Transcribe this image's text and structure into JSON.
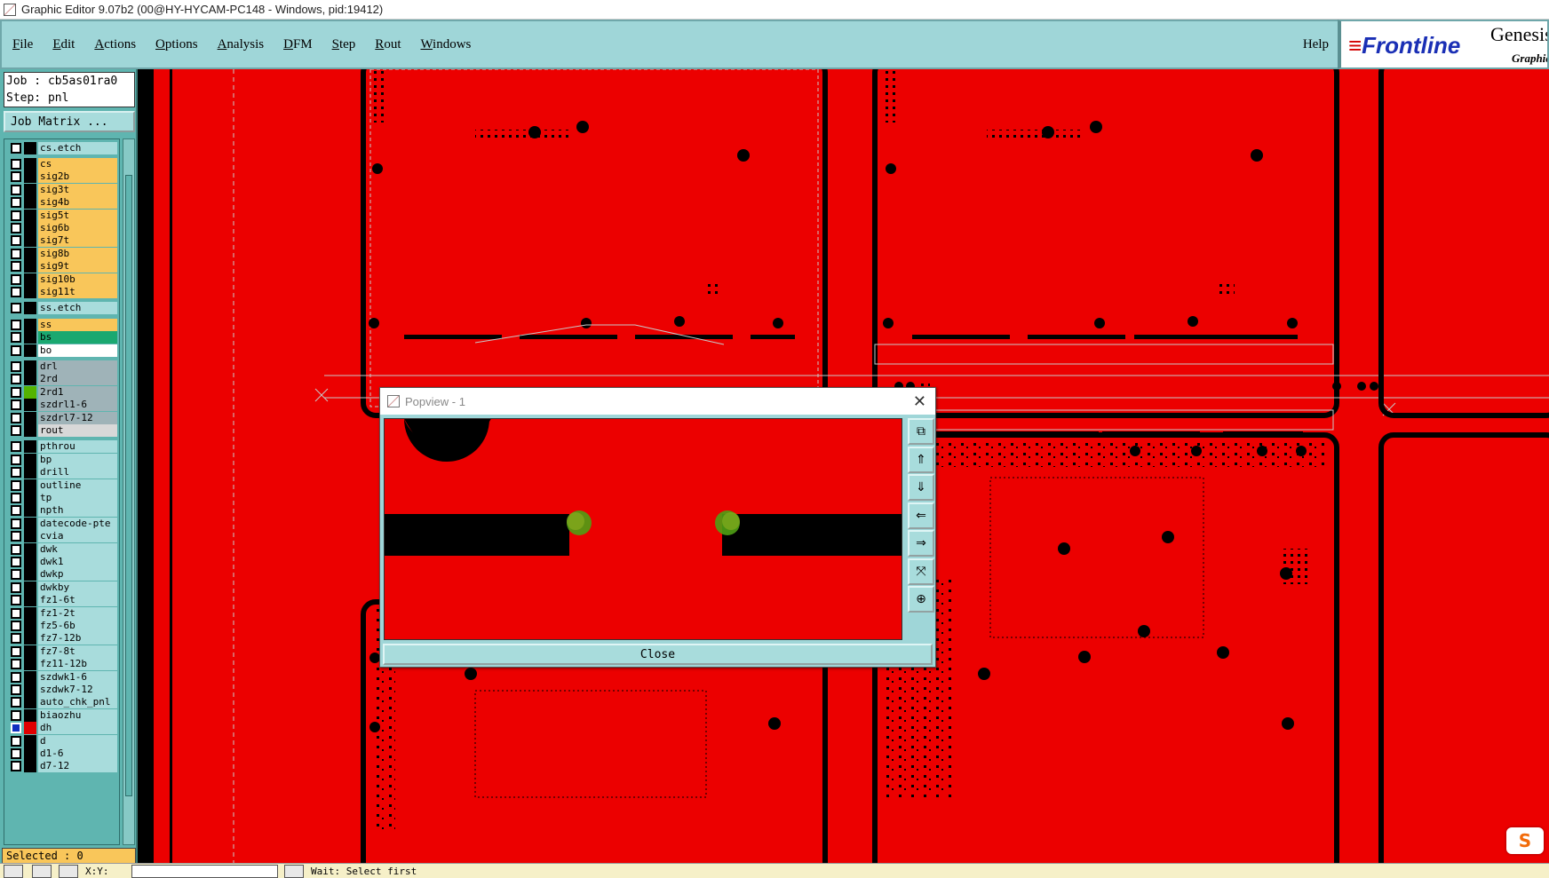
{
  "window": {
    "title": "Graphic Editor 9.07b2 (00@HY-HYCAM-PC148 - Windows, pid:19412)"
  },
  "menu": [
    {
      "label": "File",
      "key": "F",
      "rest": "ile"
    },
    {
      "label": "Edit",
      "key": "E",
      "rest": "dit"
    },
    {
      "label": "Actions",
      "key": "A",
      "rest": "ctions"
    },
    {
      "label": "Options",
      "key": "O",
      "rest": "ptions"
    },
    {
      "label": "Analysis",
      "key": "A",
      "rest": "nalysis"
    },
    {
      "label": "DFM",
      "key": "D",
      "rest": "FM"
    },
    {
      "label": "Step",
      "key": "S",
      "rest": "tep"
    },
    {
      "label": "Rout",
      "key": "R",
      "rest": "out"
    },
    {
      "label": "Windows",
      "key": "W",
      "rest": "indows"
    }
  ],
  "help_label": "Help",
  "brand": {
    "logo": "Frontline",
    "product": "Genesis",
    "subtitle": "Graphic"
  },
  "job": {
    "job_line": "Job : cb5as01ra0",
    "step_line": "Step: pnl",
    "matrix_button": "Job Matrix ..."
  },
  "layers": [
    {
      "name": "cs.etch",
      "color": "#a8dcdc",
      "swatch": "#000000",
      "gap": false
    },
    {
      "name": "cs",
      "color": "#f9c65a",
      "swatch": "#000000",
      "gap": true
    },
    {
      "name": "sig2b",
      "color": "#f9c65a",
      "swatch": "#000000",
      "gap": false
    },
    {
      "name": "sig3t",
      "color": "#f9c65a",
      "swatch": "#000000",
      "gap": false
    },
    {
      "name": "sig4b",
      "color": "#f9c65a",
      "swatch": "#000000",
      "gap": false
    },
    {
      "name": "sig5t",
      "color": "#f9c65a",
      "swatch": "#000000",
      "gap": false
    },
    {
      "name": "sig6b",
      "color": "#f9c65a",
      "swatch": "#000000",
      "gap": false
    },
    {
      "name": "sig7t",
      "color": "#f9c65a",
      "swatch": "#000000",
      "gap": false
    },
    {
      "name": "sig8b",
      "color": "#f9c65a",
      "swatch": "#000000",
      "gap": false
    },
    {
      "name": "sig9t",
      "color": "#f9c65a",
      "swatch": "#000000",
      "gap": false
    },
    {
      "name": "sig10b",
      "color": "#f9c65a",
      "swatch": "#000000",
      "gap": false
    },
    {
      "name": "sig11t",
      "color": "#f9c65a",
      "swatch": "#000000",
      "gap": false
    },
    {
      "name": "ss.etch",
      "color": "#a8dcdc",
      "swatch": "#000000",
      "gap": true
    },
    {
      "name": "ss",
      "color": "#f9c65a",
      "swatch": "#000000",
      "gap": true
    },
    {
      "name": "bs",
      "color": "#1aa870",
      "swatch": "#000000",
      "gap": false
    },
    {
      "name": "bo",
      "color": "#ffffff",
      "swatch": "#000000",
      "gap": false
    },
    {
      "name": "drl",
      "color": "#9fb3b8",
      "swatch": "#000000",
      "gap": true
    },
    {
      "name": "2rd",
      "color": "#9fb3b8",
      "swatch": "#000000",
      "gap": false
    },
    {
      "name": "2rd1",
      "color": "#9fb3b8",
      "swatch": "#54b400",
      "gap": false
    },
    {
      "name": "szdrl1-6",
      "color": "#9fb3b8",
      "swatch": "#000000",
      "gap": false
    },
    {
      "name": "szdrl7-12",
      "color": "#9fb3b8",
      "swatch": "#000000",
      "gap": false
    },
    {
      "name": "rout",
      "color": "#d8d8d8",
      "swatch": "#000000",
      "gap": false
    },
    {
      "name": "pthrou",
      "color": "#a8dcdc",
      "swatch": "#000000",
      "gap": true
    },
    {
      "name": "bp",
      "color": "#a8dcdc",
      "swatch": "#000000",
      "gap": false
    },
    {
      "name": "drill",
      "color": "#a8dcdc",
      "swatch": "#000000",
      "gap": false
    },
    {
      "name": "outline",
      "color": "#a8dcdc",
      "swatch": "#000000",
      "gap": false
    },
    {
      "name": "tp",
      "color": "#a8dcdc",
      "swatch": "#000000",
      "gap": false
    },
    {
      "name": "npth",
      "color": "#a8dcdc",
      "swatch": "#000000",
      "gap": false
    },
    {
      "name": "datecode-pte",
      "color": "#a8dcdc",
      "swatch": "#000000",
      "gap": false
    },
    {
      "name": "cvia",
      "color": "#a8dcdc",
      "swatch": "#000000",
      "gap": false
    },
    {
      "name": "dwk",
      "color": "#a8dcdc",
      "swatch": "#000000",
      "gap": false
    },
    {
      "name": "dwk1",
      "color": "#a8dcdc",
      "swatch": "#000000",
      "gap": false
    },
    {
      "name": "dwkp",
      "color": "#a8dcdc",
      "swatch": "#000000",
      "gap": false
    },
    {
      "name": "dwkby",
      "color": "#a8dcdc",
      "swatch": "#000000",
      "gap": false
    },
    {
      "name": "fz1-6t",
      "color": "#a8dcdc",
      "swatch": "#000000",
      "gap": false
    },
    {
      "name": "fz1-2t",
      "color": "#a8dcdc",
      "swatch": "#000000",
      "gap": false
    },
    {
      "name": "fz5-6b",
      "color": "#a8dcdc",
      "swatch": "#000000",
      "gap": false
    },
    {
      "name": "fz7-12b",
      "color": "#a8dcdc",
      "swatch": "#000000",
      "gap": false
    },
    {
      "name": "fz7-8t",
      "color": "#a8dcdc",
      "swatch": "#000000",
      "gap": false
    },
    {
      "name": "fz11-12b",
      "color": "#a8dcdc",
      "swatch": "#000000",
      "gap": false
    },
    {
      "name": "szdwk1-6",
      "color": "#a8dcdc",
      "swatch": "#000000",
      "gap": false
    },
    {
      "name": "szdwk7-12",
      "color": "#a8dcdc",
      "swatch": "#000000",
      "gap": false
    },
    {
      "name": "auto_chk_pnl",
      "color": "#a8dcdc",
      "swatch": "#000000",
      "gap": false
    },
    {
      "name": "biaozhu",
      "color": "#a8dcdc",
      "swatch": "#000000",
      "gap": false
    },
    {
      "name": "dh",
      "color": "#a8dcdc",
      "swatch": "#e00000",
      "gap": false,
      "active": true
    },
    {
      "name": "d",
      "color": "#a8dcdc",
      "swatch": "#000000",
      "gap": false
    },
    {
      "name": "d1-6",
      "color": "#a8dcdc",
      "swatch": "#000000",
      "gap": false
    },
    {
      "name": "d7-12",
      "color": "#a8dcdc",
      "swatch": "#000000",
      "gap": false
    }
  ],
  "selected_label": "Selected : 0",
  "popview": {
    "title": "Popview - 1",
    "close_label": "Close",
    "tools": [
      "zoom-window-icon",
      "pan-up-icon",
      "pan-down-icon",
      "pan-left-icon",
      "pan-right-icon",
      "zoom-fit-icon",
      "zoom-home-icon"
    ]
  },
  "status": {
    "coord_label": "X:Y:",
    "message": "Wait: Select first"
  },
  "colors": {
    "board": "#ec0000",
    "copper_void": "#000000",
    "panel_teal": "#9fd6d8",
    "layer_yellow": "#f9c65a"
  }
}
